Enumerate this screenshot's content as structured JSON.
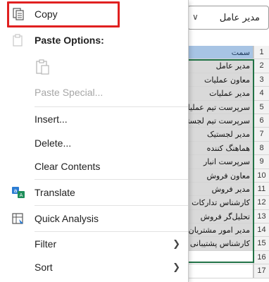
{
  "name_box": {
    "value": "مدیر عامل"
  },
  "sheet": {
    "rows": [
      {
        "num": "1",
        "text": "سمت",
        "type": "header"
      },
      {
        "num": "2",
        "text": "مدیر عامل",
        "type": "data"
      },
      {
        "num": "3",
        "text": "معاون عملیات",
        "type": "data"
      },
      {
        "num": "4",
        "text": "مدیر عملیات",
        "type": "data"
      },
      {
        "num": "5",
        "text": "سرپرست تیم عملیات",
        "type": "data"
      },
      {
        "num": "6",
        "text": "سرپرست تیم لجستیک",
        "type": "data"
      },
      {
        "num": "7",
        "text": "مدیر لجستیک",
        "type": "data"
      },
      {
        "num": "8",
        "text": "هماهنگ کننده",
        "type": "data"
      },
      {
        "num": "9",
        "text": "سرپرست انبار",
        "type": "data"
      },
      {
        "num": "10",
        "text": "معاون فروش",
        "type": "data"
      },
      {
        "num": "11",
        "text": "مدیر فروش",
        "type": "data"
      },
      {
        "num": "12",
        "text": "کارشناس تدارکات",
        "type": "data"
      },
      {
        "num": "13",
        "text": "تحلیل‌گر فروش",
        "type": "data"
      },
      {
        "num": "14",
        "text": "مدیر امور مشتریان",
        "type": "data"
      },
      {
        "num": "15",
        "text": "کارشناس پشتیبانی",
        "type": "data"
      },
      {
        "num": "16",
        "text": "",
        "type": "empty"
      },
      {
        "num": "17",
        "text": "",
        "type": "empty"
      }
    ]
  },
  "menu": {
    "copy": "Copy",
    "paste_options": "Paste Options:",
    "paste_special": "Paste Special...",
    "insert": "Insert...",
    "delete": "Delete...",
    "clear_contents": "Clear Contents",
    "translate": "Translate",
    "quick_analysis": "Quick Analysis",
    "filter": "Filter",
    "sort": "Sort"
  },
  "colors": {
    "highlight": "#e02020",
    "header_fill": "#a7c4e4",
    "selection_border": "#217346"
  }
}
